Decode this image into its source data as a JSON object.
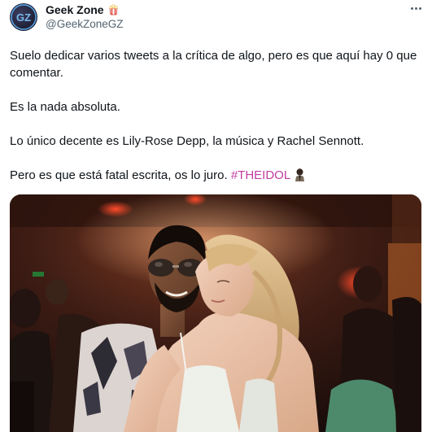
{
  "author": {
    "display_name": "Geek Zone",
    "handle": "@GeekZoneGZ",
    "avatar_text": "GZ",
    "badge_icon": "popcorn-icon"
  },
  "menu_icon": "more-options-icon",
  "tweet": {
    "p1": "Suelo dedicar varios tweets a la crítica de algo, pero es que aquí hay 0 que comentar.",
    "p2": "Es la nada absoluta.",
    "p3": "Lo único decente es Lily-Rose Depp, la música y Rachel Sennott.",
    "p4": "Pero es que está fatal escrita, os lo juro.",
    "hashtag": "#THEIDOL",
    "hashtag_emoji_icon": "the-idol-character-emoji",
    "hashtag_color": "#c13ca2"
  },
  "colors": {
    "text": "#0f1419",
    "secondary": "#536471",
    "background": "#ffffff"
  }
}
